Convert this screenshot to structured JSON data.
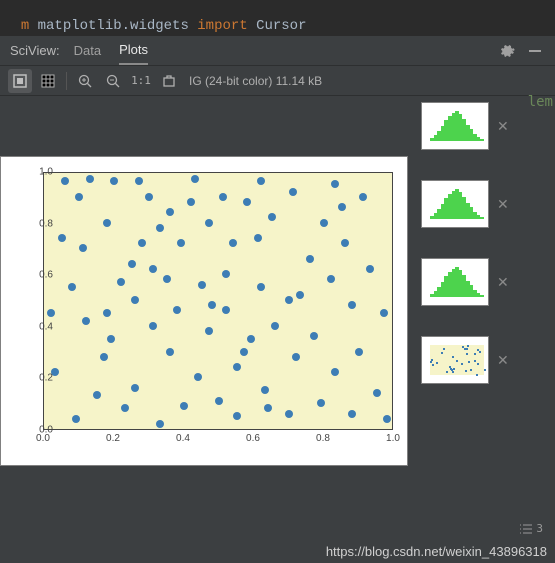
{
  "code_line": {
    "kw1": "m ",
    "mod": "matplotlib.widgets",
    "kw2": " import ",
    "sym": "Cursor"
  },
  "panel_label": "SciView:",
  "tabs": {
    "data": "Data",
    "plots": "Plots"
  },
  "toolbar": {
    "one_to_one": "1:1"
  },
  "file_info": "IG (24-bit color) 11.14 kB",
  "thumb_count": "3",
  "right_code_fragment": "lem",
  "watermark": "https://blog.csdn.net/weixin_43896318",
  "axes": {
    "yticks": [
      "0.0",
      "0.2",
      "0.4",
      "0.6",
      "0.8",
      "1.0"
    ],
    "xticks": [
      "0.0",
      "0.2",
      "0.4",
      "0.6",
      "0.8",
      "1.0"
    ]
  },
  "chart_data": {
    "type": "scatter",
    "xlabel": "",
    "ylabel": "",
    "xlim": [
      0.0,
      1.0
    ],
    "ylim": [
      0.0,
      1.0
    ],
    "x": [
      0.03,
      0.06,
      0.02,
      0.08,
      0.09,
      0.11,
      0.1,
      0.13,
      0.15,
      0.17,
      0.18,
      0.18,
      0.2,
      0.22,
      0.19,
      0.23,
      0.25,
      0.27,
      0.26,
      0.26,
      0.3,
      0.28,
      0.33,
      0.31,
      0.35,
      0.33,
      0.36,
      0.36,
      0.38,
      0.4,
      0.39,
      0.43,
      0.44,
      0.45,
      0.47,
      0.47,
      0.5,
      0.52,
      0.51,
      0.55,
      0.52,
      0.54,
      0.55,
      0.58,
      0.59,
      0.62,
      0.63,
      0.62,
      0.61,
      0.66,
      0.65,
      0.7,
      0.7,
      0.71,
      0.72,
      0.76,
      0.77,
      0.8,
      0.79,
      0.82,
      0.83,
      0.83,
      0.88,
      0.86,
      0.88,
      0.91,
      0.9,
      0.93,
      0.95,
      0.97,
      0.98,
      0.31,
      0.42,
      0.57,
      0.64,
      0.73,
      0.85,
      0.12,
      0.48,
      0.05
    ],
    "y": [
      0.22,
      0.96,
      0.45,
      0.55,
      0.04,
      0.7,
      0.9,
      0.97,
      0.13,
      0.28,
      0.45,
      0.8,
      0.96,
      0.57,
      0.35,
      0.08,
      0.64,
      0.96,
      0.5,
      0.16,
      0.9,
      0.72,
      0.02,
      0.4,
      0.58,
      0.78,
      0.3,
      0.84,
      0.46,
      0.09,
      0.72,
      0.97,
      0.2,
      0.56,
      0.38,
      0.8,
      0.11,
      0.6,
      0.9,
      0.24,
      0.46,
      0.72,
      0.05,
      0.88,
      0.35,
      0.55,
      0.15,
      0.96,
      0.74,
      0.4,
      0.82,
      0.06,
      0.5,
      0.92,
      0.28,
      0.66,
      0.36,
      0.8,
      0.1,
      0.58,
      0.95,
      0.22,
      0.48,
      0.72,
      0.06,
      0.9,
      0.3,
      0.62,
      0.14,
      0.45,
      0.04,
      0.62,
      0.88,
      0.3,
      0.08,
      0.52,
      0.86,
      0.42,
      0.48,
      0.74
    ]
  },
  "thumbnails": [
    {
      "type": "hist-green"
    },
    {
      "type": "hist-green"
    },
    {
      "type": "hist-green"
    },
    {
      "type": "scatter-mini"
    }
  ]
}
